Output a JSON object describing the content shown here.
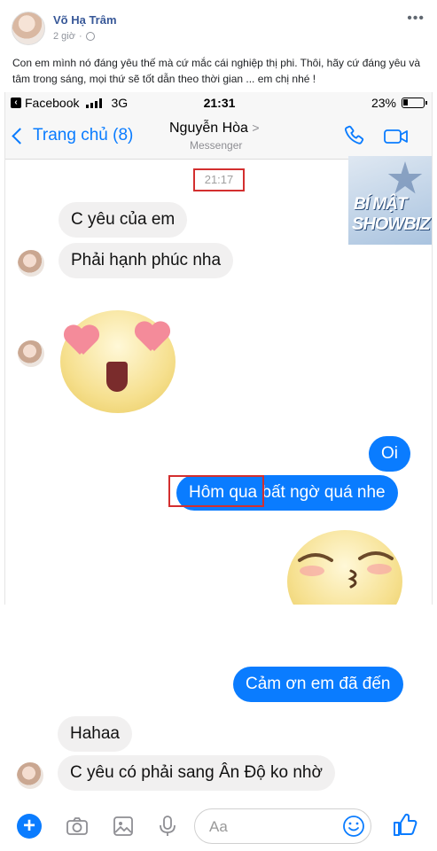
{
  "post": {
    "author": "Võ Hạ Trâm",
    "time": "2 giờ",
    "more": "•••",
    "text": "Con em mình nó đáng yêu thế mà cứ mắc cái nghiệp thị phi. Thôi, hãy cứ đáng yêu và tâm trong sáng, mọi thứ sẽ tốt dẫn theo thời gian ... em chị nhé !"
  },
  "statusbar": {
    "app": "Facebook",
    "network": "3G",
    "time": "21:31",
    "battery": "23%"
  },
  "nav": {
    "back": "Trang chủ (8)",
    "title": "Nguyễn Hòa",
    "title_chevron": ">",
    "subtitle": "Messenger"
  },
  "watermark": {
    "line1": "BÍ MẬT",
    "line2": "SHOWBIZ"
  },
  "chat": {
    "timestamp": "21:17",
    "incoming_top": [
      "C yêu của em",
      "Phải hạnh phúc nha"
    ],
    "outgoing": [
      "Oi",
      "Hôm qua bất ngờ quá nhe",
      "Cảm ơn em đã đến"
    ],
    "incoming_bottom": [
      "Hahaa",
      "C yêu có phải sang Ân Độ ko nhờ"
    ]
  },
  "composer": {
    "plus": "+",
    "placeholder": "Aa"
  },
  "colors": {
    "accent": "#0a7cff",
    "bubble_in": "#f1f0f0",
    "highlight": "#d32f2f"
  },
  "icons": [
    "globe-icon",
    "back-chevron-icon",
    "phone-icon",
    "video-icon",
    "camera-icon",
    "image-icon",
    "mic-icon",
    "smile-icon",
    "like-icon"
  ]
}
